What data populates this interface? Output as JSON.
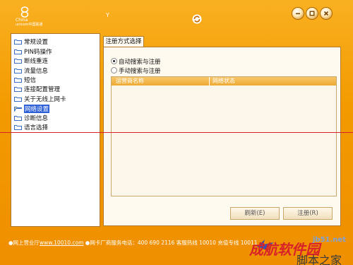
{
  "brand": {
    "line1": "China",
    "line2": "unicom中国联通"
  },
  "titlebar": {
    "signal_glyph": "Y"
  },
  "nav": {
    "items": [
      {
        "label": "常规设置",
        "selected": false
      },
      {
        "label": "PIN码操作",
        "selected": false
      },
      {
        "label": "断线重连",
        "selected": false
      },
      {
        "label": "流量信息",
        "selected": false
      },
      {
        "label": "短信",
        "selected": false
      },
      {
        "label": "连接配置管理",
        "selected": false
      },
      {
        "label": "关于无线上网卡",
        "selected": false
      },
      {
        "label": "网络设置",
        "selected": true
      },
      {
        "label": "诊断信息",
        "selected": false
      },
      {
        "label": "语言选择",
        "selected": false
      }
    ]
  },
  "panel": {
    "tab_label": "注册方式选择",
    "radio_auto": "自动搜索与注册",
    "radio_manual": "手动搜索与注册",
    "selected_mode": "auto",
    "table": {
      "col1": "运营商名称",
      "col2": "网络状态",
      "rows": []
    },
    "refresh_button": "刷新(E)",
    "register_button": "注册(R)"
  },
  "footer": {
    "prefix": "●网上营业厅",
    "link": "www.10010.com",
    "rest": " ●网卡厂商服务电话：400 690 2116  客服热线 10010  充值专线 10011"
  },
  "watermark": {
    "site": "jb51.net",
    "brand": "成航软件园",
    "tag": "脚本之家"
  },
  "colors": {
    "frame_orange": "#f39a00",
    "selection_blue": "#2c5fd6",
    "red_line": "#d8222a"
  }
}
